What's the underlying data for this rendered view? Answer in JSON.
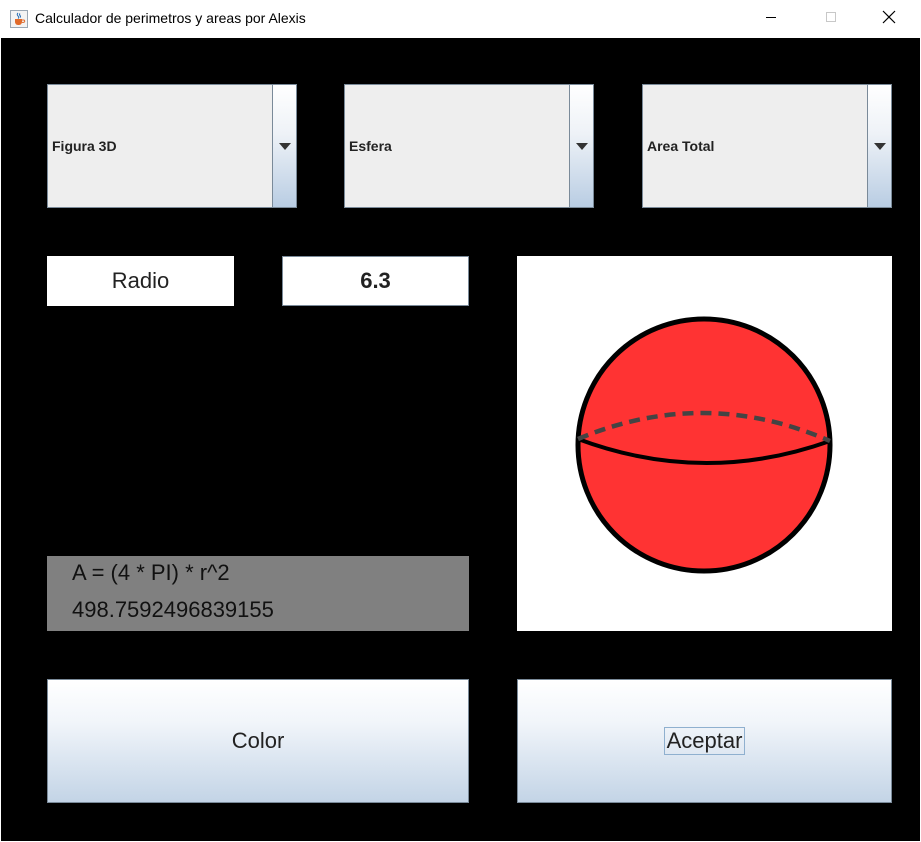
{
  "window": {
    "title": "Calculador de perimetros y areas por Alexis"
  },
  "selectors": {
    "figure_type": "Figura 3D",
    "shape": "Esfera",
    "measure": "Area Total"
  },
  "input": {
    "label": "Radio",
    "value": "6.3"
  },
  "result": {
    "formula": "A = (4 * PI) * r^2",
    "value": "498.7592496839155"
  },
  "drawing": {
    "shape": "sphere",
    "fill_color": "#ff3333",
    "outline_color": "#000000",
    "equator_dash_color": "#444444"
  },
  "buttons": {
    "color_label": "Color",
    "accept_label": "Aceptar"
  },
  "icons": {
    "app": "java-cup-icon",
    "minimize": "minimize-icon",
    "maximize": "maximize-icon",
    "close": "close-icon",
    "dropdown": "triangle-down-icon"
  }
}
